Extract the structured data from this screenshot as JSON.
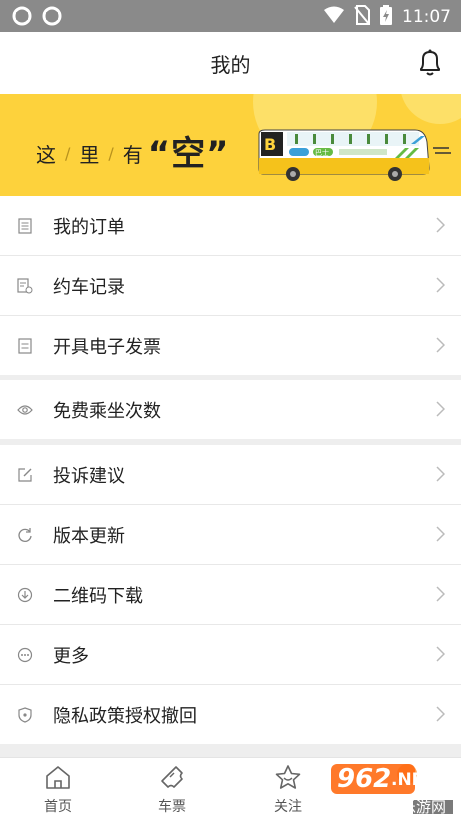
{
  "status_bar": {
    "time": "11:07",
    "battery_level": 0.9,
    "icons": [
      "sync-icon",
      "sync-icon",
      "wifi-icon",
      "no-sim-icon",
      "battery-icon"
    ]
  },
  "header": {
    "title": "我的",
    "icons": [
      "bell-icon"
    ]
  },
  "banner": {
    "slogan_chars": [
      "这",
      "里",
      "有"
    ],
    "slogan_big": "“空”",
    "bus_text": "巴士"
  },
  "menu_groups": [
    [
      {
        "label": "我的订单",
        "icon": "order-icon"
      },
      {
        "label": "约车记录",
        "icon": "record-icon"
      },
      {
        "label": "开具电子发票",
        "icon": "invoice-icon"
      }
    ],
    [
      {
        "label": "免费乘坐次数",
        "icon": "eye-icon"
      }
    ],
    [
      {
        "label": "投诉建议",
        "icon": "edit-icon"
      },
      {
        "label": "版本更新",
        "icon": "refresh-icon"
      },
      {
        "label": "二维码下载",
        "icon": "download-icon"
      },
      {
        "label": "更多",
        "icon": "more-icon"
      },
      {
        "label": "隐私政策授权撤回",
        "icon": "shield-icon"
      }
    ]
  ],
  "tab_bar": {
    "tabs": [
      {
        "label": "首页",
        "icon": "home-icon"
      },
      {
        "label": "车票",
        "icon": "ticket-icon"
      },
      {
        "label": "关注",
        "icon": "star-icon"
      }
    ]
  },
  "watermark": {
    "number": "962",
    "suffix": ".NET",
    "site_text": "乐游网"
  },
  "colors": {
    "accent": "#fdd23c",
    "status_bar": "#8a8a8a",
    "background": "#eeeeee"
  }
}
